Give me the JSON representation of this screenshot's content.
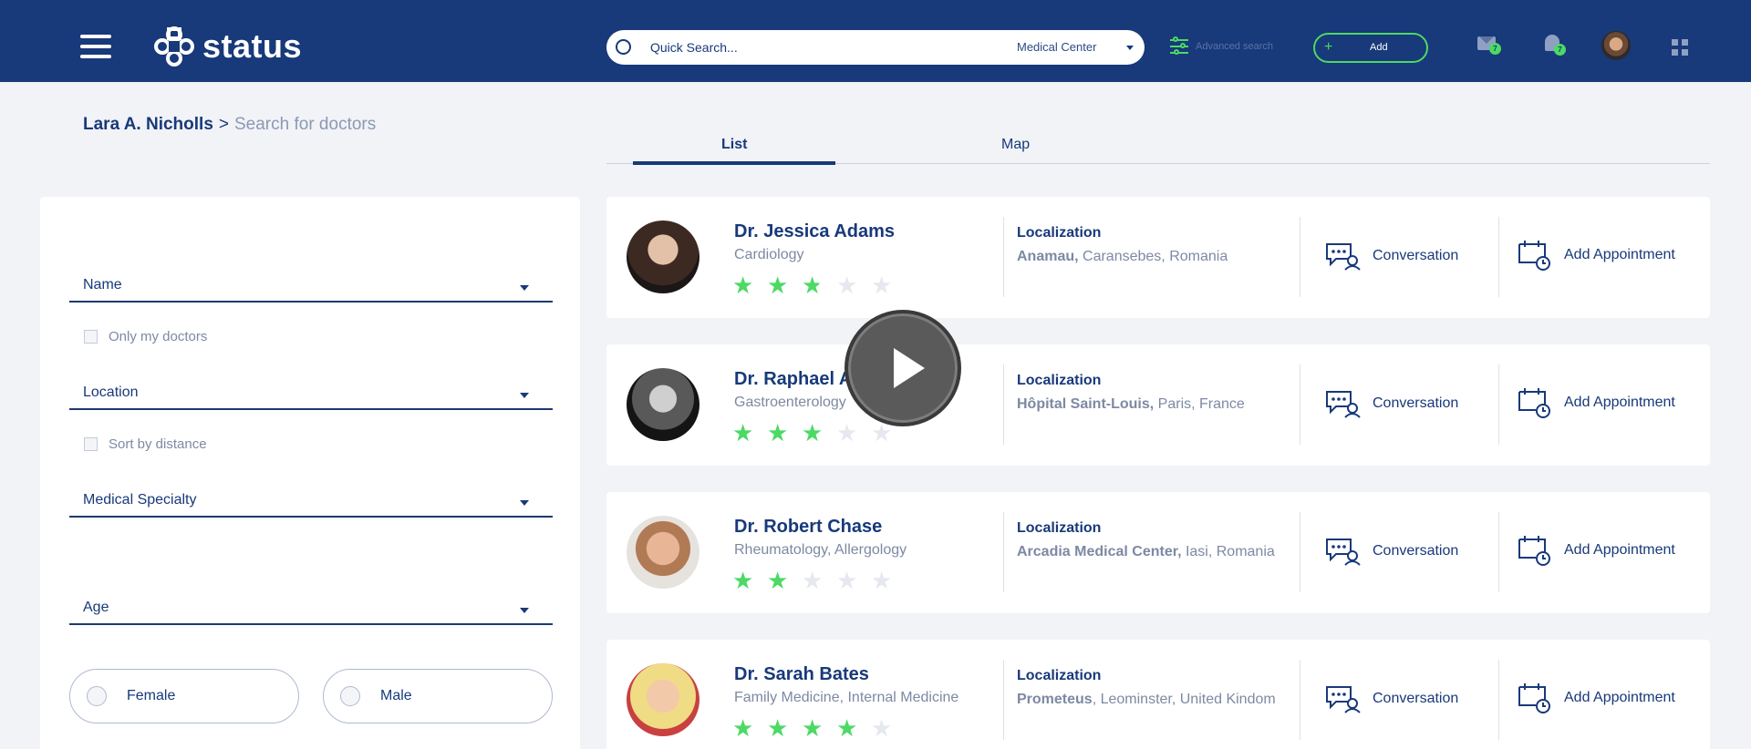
{
  "header": {
    "brand": "status",
    "search_placeholder": "Quick Search...",
    "search_scope": "Medical Center",
    "advanced_search": "Advanced search",
    "add_label": "Add",
    "add_plus": "+",
    "messages_badge": "7",
    "notifications_badge": "7"
  },
  "breadcrumb": {
    "user": "Lara A. Nicholls",
    "separator": ">",
    "page": "Search for doctors"
  },
  "filters": {
    "name": "Name",
    "only_my_doctors": "Only my doctors",
    "location": "Location",
    "sort_by_distance": "Sort by distance",
    "medical_specialty": "Medical Specialty",
    "age": "Age",
    "female": "Female",
    "male": "Male"
  },
  "tabs": {
    "list": "List",
    "map": "Map",
    "active": "list"
  },
  "doctors": [
    {
      "name": "Dr. Jessica Adams",
      "specialty": "Cardiology",
      "rating": 2.5,
      "loc_title": "Localization",
      "loc_bold": "Anamau,",
      "loc_rest": " Caransebes, Romania",
      "conversation": "Conversation",
      "appointment": "Add Appointment"
    },
    {
      "name": "Dr. Raphael A",
      "specialty": "Gastroenterology",
      "rating": 3,
      "loc_title": "Localization",
      "loc_bold": "Hôpital Saint-Louis,",
      "loc_rest": " Paris, France",
      "conversation": "Conversation",
      "appointment": "Add Appointment"
    },
    {
      "name": "Dr. Robert Chase",
      "specialty": "Rheumatology, Allergology",
      "rating": 2,
      "loc_title": "Localization",
      "loc_bold": "Arcadia Medical Center,",
      "loc_rest": " Iasi, Romania",
      "conversation": "Conversation",
      "appointment": "Add Appointment"
    },
    {
      "name": "Dr. Sarah Bates",
      "specialty": "Family Medicine, Internal Medicine",
      "rating": 4,
      "loc_title": "Localization",
      "loc_bold": "Prometeus",
      "loc_rest": ", Leominster, United Kindom",
      "conversation": "Conversation",
      "appointment": "Add Appointment"
    }
  ],
  "colors": {
    "header_bg": "#18397a",
    "accent": "#4cd964",
    "text_primary": "#18397a",
    "text_muted": "#7d89a3"
  }
}
